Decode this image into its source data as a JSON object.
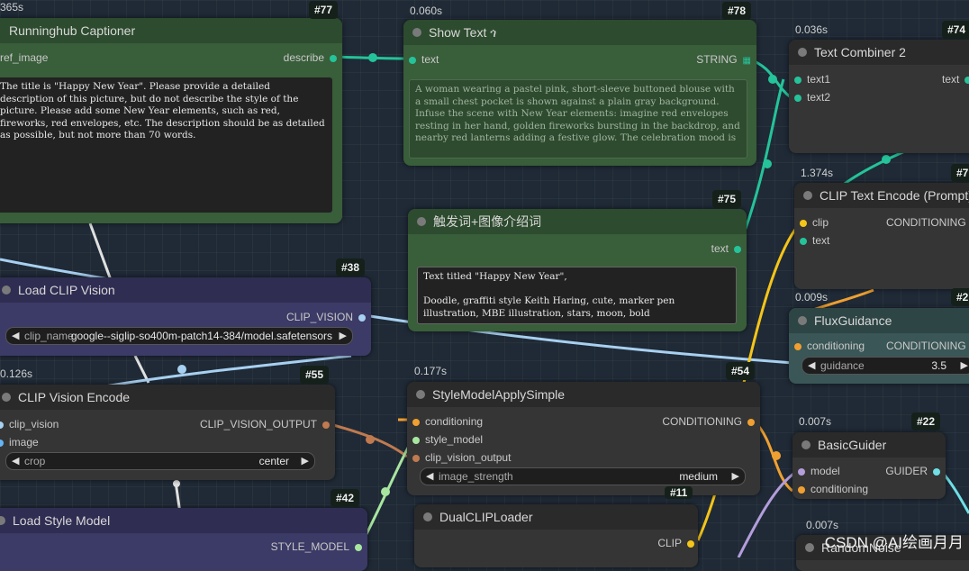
{
  "timings": [
    "365s",
    "0.060s",
    "0.036s",
    "1.374s",
    "0.009s",
    "0.126s",
    "0.177s",
    "0.007s",
    "0.007s"
  ],
  "badges": [
    "#77",
    "#78",
    "#74",
    "#75",
    "#38",
    "#55",
    "#54",
    "#22",
    "#42",
    "#11",
    "#7",
    "#2"
  ],
  "colors": {
    "clip": "#f5c518",
    "conditioning": "#f0a030",
    "text": "#25c39a",
    "clip_vision": "#a8d0f0",
    "style_model": "#a8e6a0",
    "model": "#b39ddb",
    "guider": "#6fe0e6",
    "image": "#64b5f6",
    "clip_vision_output": "#c07a50"
  },
  "nodes": {
    "captioner": {
      "title": "Runninghub Captioner",
      "in_ref": "ref_image",
      "out_describe": "describe",
      "prompt": "The title is \"Happy New Year\". Please provide a detailed description of this picture, but do not describe the style of the picture. Please add some New Year elements, such as red, fireworks, red envelopes, etc. The description should be as detailed as possible, but not more than 70 words."
    },
    "show_text": {
      "title": "Show Text",
      "title_icon": "link-icon",
      "in_text": "text",
      "out_string": "STRING",
      "content": "A woman wearing a pastel pink, short-sleeve buttoned blouse with a small chest pocket is shown against a plain gray background. Infuse the scene with New Year elements: imagine red envelopes resting in her hand, golden fireworks bursting in the backdrop, and nearby red lanterns adding a festive glow. The celebration mood is"
    },
    "text_combiner": {
      "title": "Text Combiner 2",
      "in_text1": "text1",
      "in_text2": "text2",
      "out_text": "text"
    },
    "trigger": {
      "title": "触发词+图像介绍词",
      "out_text": "text",
      "content": "Text titled \"Happy New Year\",\n\nDoodle, graffiti style Keith Haring, cute, marker pen illustration, MBE illustration, stars, moon, bold"
    },
    "clip_text_encode": {
      "title": "CLIP Text Encode (Prompt)",
      "in_clip": "clip",
      "in_text": "text",
      "out_conditioning": "CONDITIONING"
    },
    "load_clip_vision": {
      "title": "Load CLIP Vision",
      "out_clip_vision": "CLIP_VISION",
      "w_label": "clip_name",
      "w_value": "google--siglip-so400m-patch14-384/model.safetensors"
    },
    "flux_guidance": {
      "title": "FluxGuidance",
      "in_conditioning": "conditioning",
      "out_conditioning": "CONDITIONING",
      "w_label": "guidance",
      "w_value": "3.5"
    },
    "clip_vision_encode": {
      "title": "CLIP Vision Encode",
      "in_clip_vision": "clip_vision",
      "in_image": "image",
      "out": "CLIP_VISION_OUTPUT",
      "w_label": "crop",
      "w_value": "center"
    },
    "style_apply": {
      "title": "StyleModelApplySimple",
      "in_conditioning": "conditioning",
      "in_style_model": "style_model",
      "in_clip_vision_output": "clip_vision_output",
      "out_conditioning": "CONDITIONING",
      "w_label": "image_strength",
      "w_value": "medium"
    },
    "basic_guider": {
      "title": "BasicGuider",
      "in_model": "model",
      "in_conditioning": "conditioning",
      "out_guider": "GUIDER"
    },
    "load_style": {
      "title": "Load Style Model",
      "out_style_model": "STYLE_MODEL"
    },
    "dual_clip": {
      "title": "DualCLIPLoader",
      "out_clip": "CLIP"
    },
    "random_noise": {
      "title": "RandomNoise"
    }
  },
  "watermark": "CSDN @AI绘画月月"
}
